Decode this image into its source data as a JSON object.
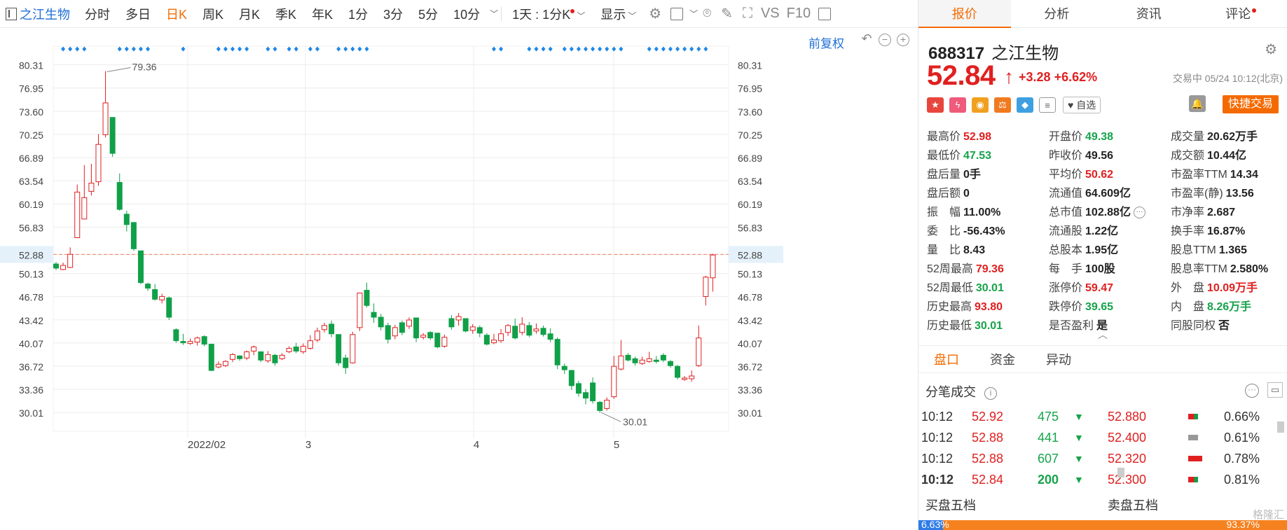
{
  "toolbar": {
    "stock_name": "之江生物",
    "periods": [
      "分时",
      "多日",
      "日K",
      "周K",
      "月K",
      "季K",
      "年K",
      "1分",
      "3分",
      "5分",
      "10分"
    ],
    "active_period": "日K",
    "range_label": "1天 : 1分K",
    "display_label": "显示",
    "vs_label": "VS",
    "f10_label": "F10",
    "adjust_label": "前复权"
  },
  "chart": {
    "y_ticks": [
      "80.31",
      "76.95",
      "73.60",
      "70.25",
      "66.89",
      "63.54",
      "60.19",
      "56.83",
      "52.88",
      "50.13",
      "46.78",
      "43.42",
      "40.07",
      "36.72",
      "33.36",
      "30.01"
    ],
    "current_price_label": "52.88",
    "high_marker": "79.36",
    "low_marker": "30.01",
    "x_labels": [
      "2022/02",
      "3",
      "4",
      "5"
    ],
    "colors": {
      "up": "#e02020",
      "down": "#10a048",
      "grid": "#ececec",
      "ref_line": "#f08060",
      "marker": "#1e88e5"
    }
  },
  "panel": {
    "tabs": [
      "报价",
      "分析",
      "资讯",
      "评论"
    ],
    "active_tab": "报价",
    "code": "688317",
    "name": "之江生物",
    "price": "52.84",
    "change": "+3.28",
    "change_pct": "+6.62%",
    "status": "交易中 05/24 10:12(北京)",
    "watch_label": "自选",
    "fast_trade_label": "快捷交易",
    "quote_rows": [
      [
        [
          "最高价",
          "52.98",
          "up"
        ],
        [
          "开盘价",
          "49.38",
          "down"
        ],
        [
          "成交量",
          "20.62万手",
          ""
        ]
      ],
      [
        [
          "最低价",
          "47.53",
          "down"
        ],
        [
          "昨收价",
          "49.56",
          ""
        ],
        [
          "成交额",
          "10.44亿",
          ""
        ]
      ],
      [
        [
          "盘后量",
          "0手",
          ""
        ],
        [
          "平均价",
          "50.62",
          "up"
        ],
        [
          "市盈率TTM",
          "14.34",
          ""
        ]
      ],
      [
        [
          "盘后额",
          "0",
          ""
        ],
        [
          "流通值",
          "64.609亿",
          ""
        ],
        [
          "市盈率(静)",
          "13.56",
          ""
        ]
      ],
      [
        [
          "振　幅",
          "11.00%",
          ""
        ],
        [
          "总市值",
          "102.88亿",
          ""
        ],
        [
          "市净率",
          "2.687",
          ""
        ]
      ],
      [
        [
          "委　比",
          "-56.43%",
          ""
        ],
        [
          "流通股",
          "1.22亿",
          ""
        ],
        [
          "换手率",
          "16.87%",
          ""
        ]
      ],
      [
        [
          "量　比",
          "8.43",
          ""
        ],
        [
          "总股本",
          "1.95亿",
          ""
        ],
        [
          "股息TTM",
          "1.365",
          ""
        ]
      ],
      [
        [
          "52周最高",
          "79.36",
          "up"
        ],
        [
          "每　手",
          "100股",
          ""
        ],
        [
          "股息率TTM",
          "2.580%",
          ""
        ]
      ],
      [
        [
          "52周最低",
          "30.01",
          "down"
        ],
        [
          "涨停价",
          "59.47",
          "up"
        ],
        [
          "外　盘",
          "10.09万手",
          "up"
        ]
      ],
      [
        [
          "历史最高",
          "93.80",
          "up"
        ],
        [
          "跌停价",
          "39.65",
          "down"
        ],
        [
          "内　盘",
          "8.26万手",
          "down"
        ]
      ],
      [
        [
          "历史最低",
          "30.01",
          "down"
        ],
        [
          "是否盈利",
          "是",
          ""
        ],
        [
          "同股同权",
          "否",
          ""
        ]
      ]
    ],
    "sub_tabs": [
      "盘口",
      "资金",
      "异动"
    ],
    "active_sub_tab": "盘口",
    "tick_title": "分笔成交",
    "ticks": [
      {
        "time": "10:12",
        "price": "52.92",
        "vol": "475",
        "bid": "52.880",
        "pct": "0.66%",
        "bold": false
      },
      {
        "time": "10:12",
        "price": "52.88",
        "vol": "441",
        "bid": "52.400",
        "pct": "0.61%",
        "bold": false
      },
      {
        "time": "10:12",
        "price": "52.88",
        "vol": "607",
        "bid": "52.320",
        "pct": "0.78%",
        "bold": false
      },
      {
        "time": "10:12",
        "price": "52.84",
        "vol": "200",
        "bid": "52.300",
        "pct": "0.81%",
        "bold": true
      }
    ],
    "buy_five_label": "买盘五档",
    "sell_five_label": "卖盘五档",
    "buy_pct": "6.63%",
    "sell_pct": "93.37%",
    "watermark": "格隆汇"
  }
}
